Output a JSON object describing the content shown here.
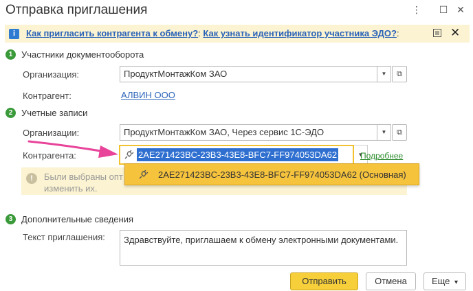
{
  "window": {
    "title": "Отправка приглашения",
    "controls": [
      "⋮",
      "☐",
      "✕"
    ]
  },
  "infobar": {
    "link_invite": "Как пригласить контрагента к обмену?",
    "separator": ":",
    "link_identifier": "Как узнать идентификатор участника ЭДО?",
    "trailing": ":"
  },
  "section1": {
    "num": "1",
    "title": "Участники документооборота",
    "org_label": "Организация:",
    "org_value": "ПродуктМонтажКом ЗАО",
    "counterparty_label": "Контрагент:",
    "counterparty_value": "АЛВИН ООО"
  },
  "section2": {
    "num": "2",
    "title": "Учетные записи",
    "orgs_label": "Организации:",
    "orgs_value": "ПродуктМонтажКом ЗАО, Через сервис 1С-ЭДО",
    "counterparty_label": "Контрагента:",
    "counterparty_id": "2AE271423BC-23B3-43E8-BFC7-FF974053DA62",
    "details_link": "Подробнее",
    "suggestion": "2AE271423BC-23B3-43E8-BFC7-FF974053DA62 (Основная)",
    "note_line1": "Были выбраны опт",
    "note_line2": "изменить их."
  },
  "section3": {
    "num": "3",
    "title": "Дополнительные сведения",
    "text_label": "Текст приглашения:",
    "text_value": "Здравствуйте, приглашаем к обмену электронными документами."
  },
  "buttons": {
    "send": "Отправить",
    "cancel": "Отмена",
    "more": "Еще",
    "more_arrow": "▾"
  },
  "colors": {
    "accent_yellow": "#f6cf3a",
    "link_blue": "#2a63b8",
    "section_green": "#3a9a3a",
    "arrow_pink": "#e8449a",
    "selection_blue": "#2e6fd0"
  },
  "icons": {
    "info": "info-icon",
    "close": "close-icon",
    "list": "list-icon",
    "plug": "plug-icon",
    "warning": "warning-icon"
  }
}
